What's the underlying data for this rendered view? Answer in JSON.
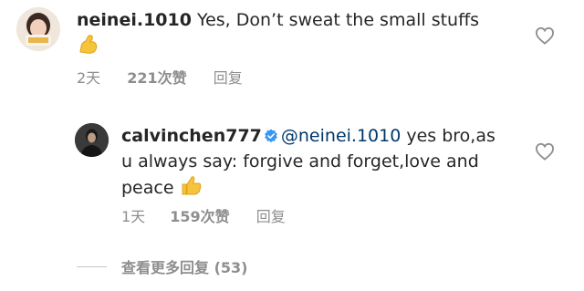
{
  "comments": [
    {
      "username": "neinei.1010",
      "text": " Yes, Don’t sweat the small stuffs",
      "emoji_icon": "flexed-biceps-icon",
      "time": "2天",
      "likes": "221次赞",
      "reply_label": "回复"
    },
    {
      "username": "calvinchen777",
      "verified_icon": "verified-badge-icon",
      "mention": "@neinei.1010",
      "text": " yes bro,as u always say: forgive and forget,love and peace",
      "emoji_icon": "thumbs-up-icon",
      "time": "1天",
      "likes": "159次赞",
      "reply_label": "回复"
    }
  ],
  "view_more_replies": "查看更多回复 (53)",
  "colors": {
    "text": "#262626",
    "secondary": "#8e8e8e",
    "mention": "#00376b",
    "verified": "#3897f0"
  }
}
